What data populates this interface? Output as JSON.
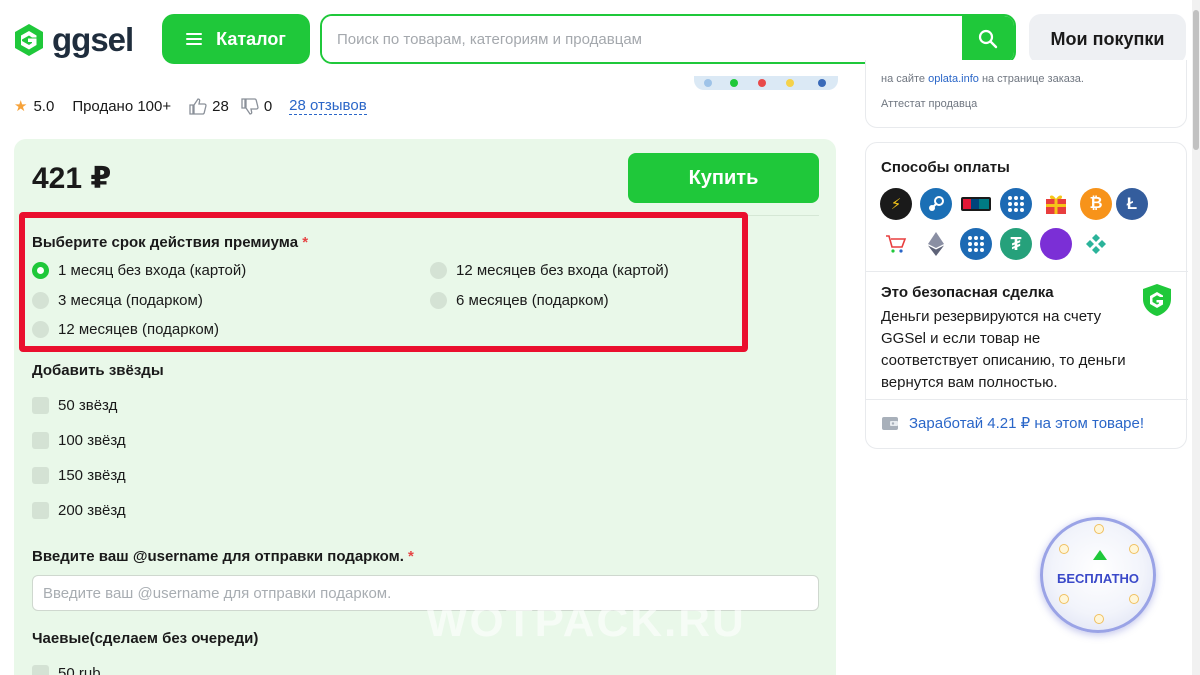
{
  "header": {
    "logo_text": "ggsel",
    "catalog_label": "Каталог",
    "search_placeholder": "Поиск по товарам, категориям и продавцам",
    "purchases_label": "Мои покупки"
  },
  "stats": {
    "rating": "5.0",
    "sold": "Продано 100+",
    "likes": "28",
    "dislikes": "0",
    "reviews": "28 отзывов"
  },
  "product": {
    "price": "421 ₽",
    "buy_label": "Купить",
    "premium_title": "Выберите срок действия премиума",
    "required_mark": "*",
    "premium_options": [
      {
        "label": "1 месяц без входа (картой)",
        "checked": true
      },
      {
        "label": "12 месяцев без входа (картой)",
        "checked": false
      },
      {
        "label": "3 месяца (подарком)",
        "checked": false
      },
      {
        "label": "6 месяцев (подарком)",
        "checked": false
      },
      {
        "label": "12 месяцев (подарком)",
        "checked": false
      }
    ],
    "stars_title": "Добавить звёзды",
    "stars_options": [
      "50 звёзд",
      "100 звёзд",
      "150 звёзд",
      "200 звёзд"
    ],
    "username_title": "Введите ваш @username для отправки подарком.",
    "username_placeholder": "Введите ваш @username для отправки подарком.",
    "tips_title": "Чаевые(сделаем без очереди)",
    "tips_options": [
      "50 rub"
    ]
  },
  "watermark": "WOTPACK.RU",
  "sidebar": {
    "info_line_prefix": "на сайте",
    "info_line_link": "oplata.info",
    "info_line_suffix": "на странице заказа.",
    "seller_attest": "Аттестат продавца",
    "payment_title": "Способы оплаты",
    "payment_icons": [
      "lightning-icon",
      "steam-icon",
      "unionpay-card-icon",
      "webmoney-icon",
      "gift-icon",
      "bitcoin-icon",
      "litecoin-icon",
      "cart-icon",
      "ethereum-icon",
      "webmoney-globe-icon",
      "tether-icon",
      "crescent-icon",
      "diamond-pattern-icon"
    ],
    "safe_title": "Это безопасная сделка",
    "safe_text": "Деньги резервируются на счету GGSel и если товар не соответствует описанию, то деньги вернутся вам полностью.",
    "earn_label": "Заработай 4.21 ₽ на этом товаре!"
  },
  "free_badge": {
    "label": "БЕСПЛАТНО"
  },
  "colors": {
    "brand_green": "#1fc83a",
    "card_bg": "#e9f8e9",
    "highlight_red": "#ea0f2e",
    "link_blue": "#2a66c8"
  }
}
